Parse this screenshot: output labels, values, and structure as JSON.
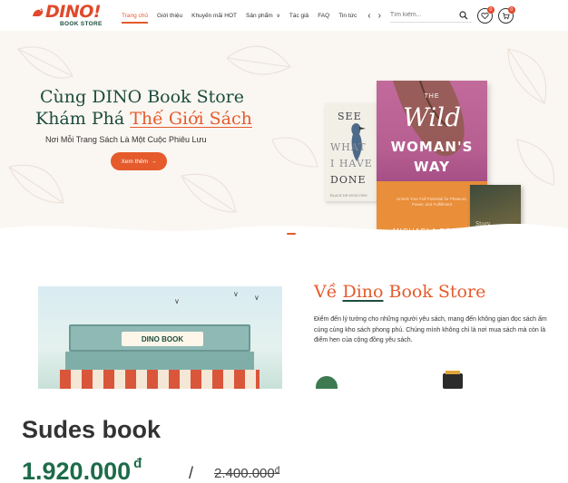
{
  "header": {
    "logo_text": "DINO!",
    "logo_sub": "BOOK STORE",
    "nav": [
      {
        "label": "Trang chủ",
        "active": true
      },
      {
        "label": "Giới thiệu",
        "active": false
      },
      {
        "label": "Khuyến mãi HOT",
        "active": false
      },
      {
        "label": "Sản phẩm",
        "active": false,
        "has_dropdown": true
      },
      {
        "label": "Tác giả",
        "active": false
      },
      {
        "label": "FAQ",
        "active": false
      },
      {
        "label": "Tin tức",
        "active": false
      }
    ],
    "search_placeholder": "Tìm kiếm...",
    "wishlist_count": "0",
    "cart_count": "0",
    "accent_color": "#e55b2c"
  },
  "hero": {
    "title_line1": "Cùng DINO Book Store",
    "title_line2_prefix": "Khám Phá",
    "title_line2_highlight": "Thế Giới Sách",
    "subtitle": "Nơi Mỗi Trang Sách Là Một Cuộc Phiêu Lưu",
    "cta_label": "Xem thêm",
    "books": {
      "see": {
        "lines": [
          "SEE",
          "WHAT",
          "I HAVE",
          "DONE"
        ],
        "author": "BLACK DE MOSCOWS"
      },
      "wild": {
        "the": "THE",
        "wild": "Wild",
        "woman": "WOMAN'S",
        "way": "WAY",
        "tagline": "Unlock Your Full Potential for Pleasure, Power, and Fulfillment",
        "author": "MICHAELA BOEHM"
      },
      "third": {
        "title": "Story"
      }
    }
  },
  "about": {
    "title_prefix": "Về",
    "title_underlined": "Dino",
    "title_suffix": "Book Store",
    "sign_text": "DINO BOOK",
    "description": "Điểm đến lý tưởng cho những người yêu sách, mang đến không gian đọc sách ấm cúng cùng kho sách phong phú. Chúng mình không chỉ là nơi mua sách mà còn là điểm hẹn của cộng đồng yêu sách."
  },
  "product": {
    "name": "Sudes book",
    "price": "1.920.000",
    "currency": "đ",
    "separator": "/",
    "old_price": "2.400.000",
    "price_color": "#1d6b4a"
  }
}
